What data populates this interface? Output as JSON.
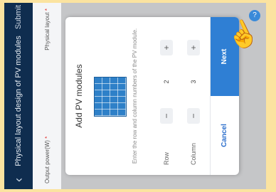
{
  "appbar": {
    "back_icon": "chevron-left-icon",
    "title": "Physical layout design of PV modules",
    "submit_label": "Submit"
  },
  "form": {
    "output_power_label": "Output power(W)",
    "physical_layout_label": "Physical layout",
    "required_mark": "*"
  },
  "dialog": {
    "title": "Add PV modules",
    "description": "Enter the row and column numbers of the PV module.",
    "row_label": "Row",
    "row_value": "2",
    "column_label": "Column",
    "column_value": "3",
    "minus_symbol": "−",
    "plus_symbol": "+",
    "cancel_label": "Cancel",
    "next_label": "Next"
  },
  "help_icon": "help-icon",
  "colors": {
    "appbar": "#0f2d4f",
    "accent": "#2f7fd4",
    "frame": "#fbe3a0"
  }
}
